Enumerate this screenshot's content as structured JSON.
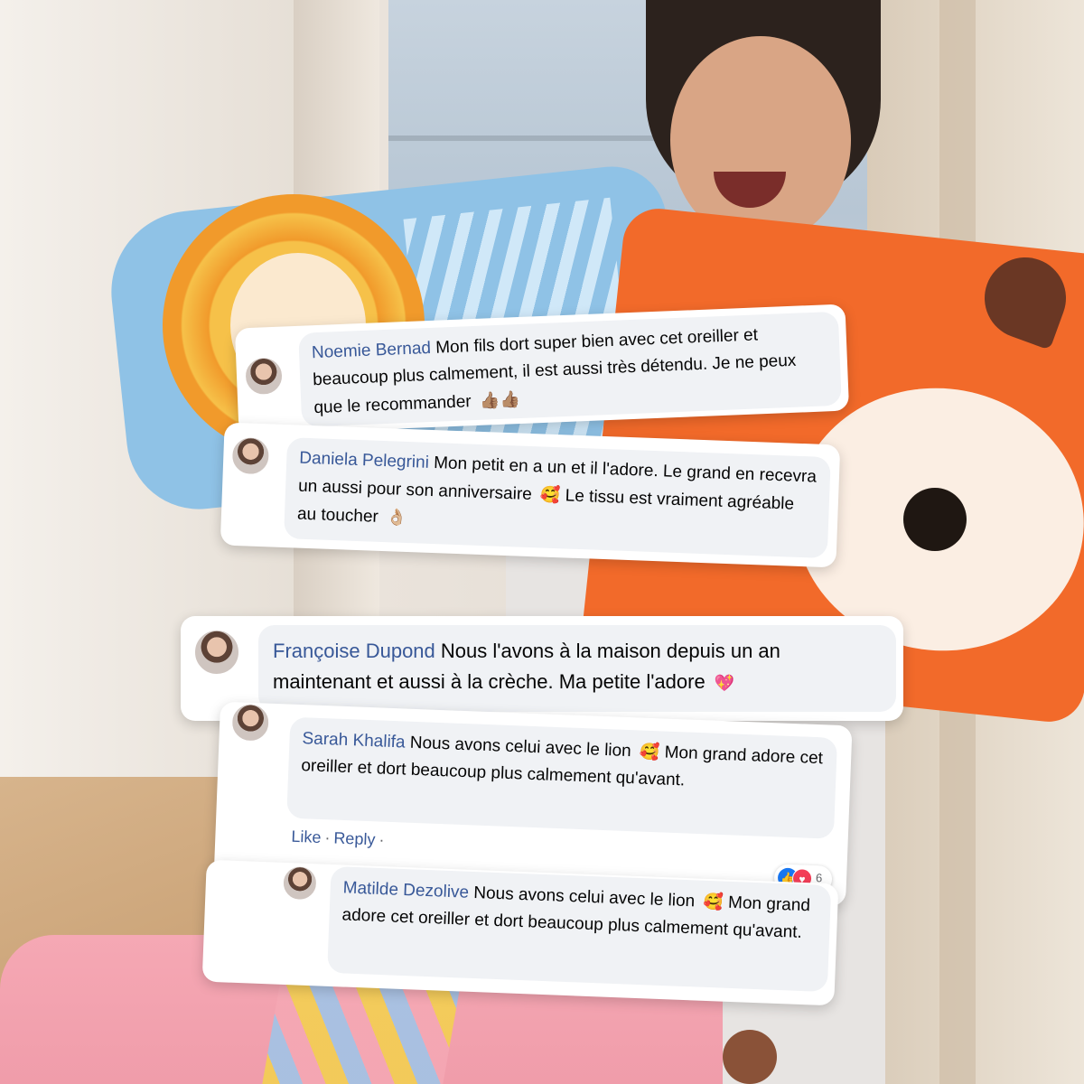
{
  "colors": {
    "author_link": "#385898",
    "bubble_bg": "#f0f2f5",
    "card_bg": "#ffffff"
  },
  "comments": [
    {
      "author": "Noemie Bernad",
      "text": "Mon fils dort super bien avec cet oreiller et beaucoup plus calmement, il est aussi très détendu. Je ne peux que le recommander",
      "emoji": "👍🏽👍🏽",
      "avatar_icon": "profile-photo-icon"
    },
    {
      "author": "Daniela Pelegrini",
      "text": "Mon petit en a un et il l'adore. Le grand en recevra un aussi pour son anniversaire",
      "emoji": "🥰",
      "text_after": "Le tissu est vraiment agréable au toucher",
      "emoji_after": "👌🏼",
      "avatar_icon": "profile-photo-icon"
    },
    {
      "author": "Françoise Dupond",
      "text": "Nous l'avons à la maison depuis un an maintenant et aussi à la crèche. Ma petite l'adore",
      "emoji": "💖",
      "avatar_icon": "profile-photo-icon"
    },
    {
      "author": "Sarah Khalifa",
      "text": "Nous avons celui avec le lion",
      "emoji": "🥰",
      "text_after": "Mon grand adore cet oreiller et dort beaucoup plus calmement qu'avant.",
      "avatar_icon": "profile-photo-icon",
      "actions": {
        "like": "Like",
        "separator": "·",
        "reply": "Reply",
        "trailing": "·"
      },
      "reactions": {
        "count": "6",
        "types": [
          "like-icon",
          "love-icon"
        ]
      }
    },
    {
      "author": "Matilde Dezolive",
      "text": "Nous avons celui avec le lion",
      "emoji": "🥰",
      "text_after": "Mon grand adore cet oreiller et dort beaucoup plus calmement qu'avant.",
      "avatar_icon": "profile-photo-icon"
    }
  ]
}
